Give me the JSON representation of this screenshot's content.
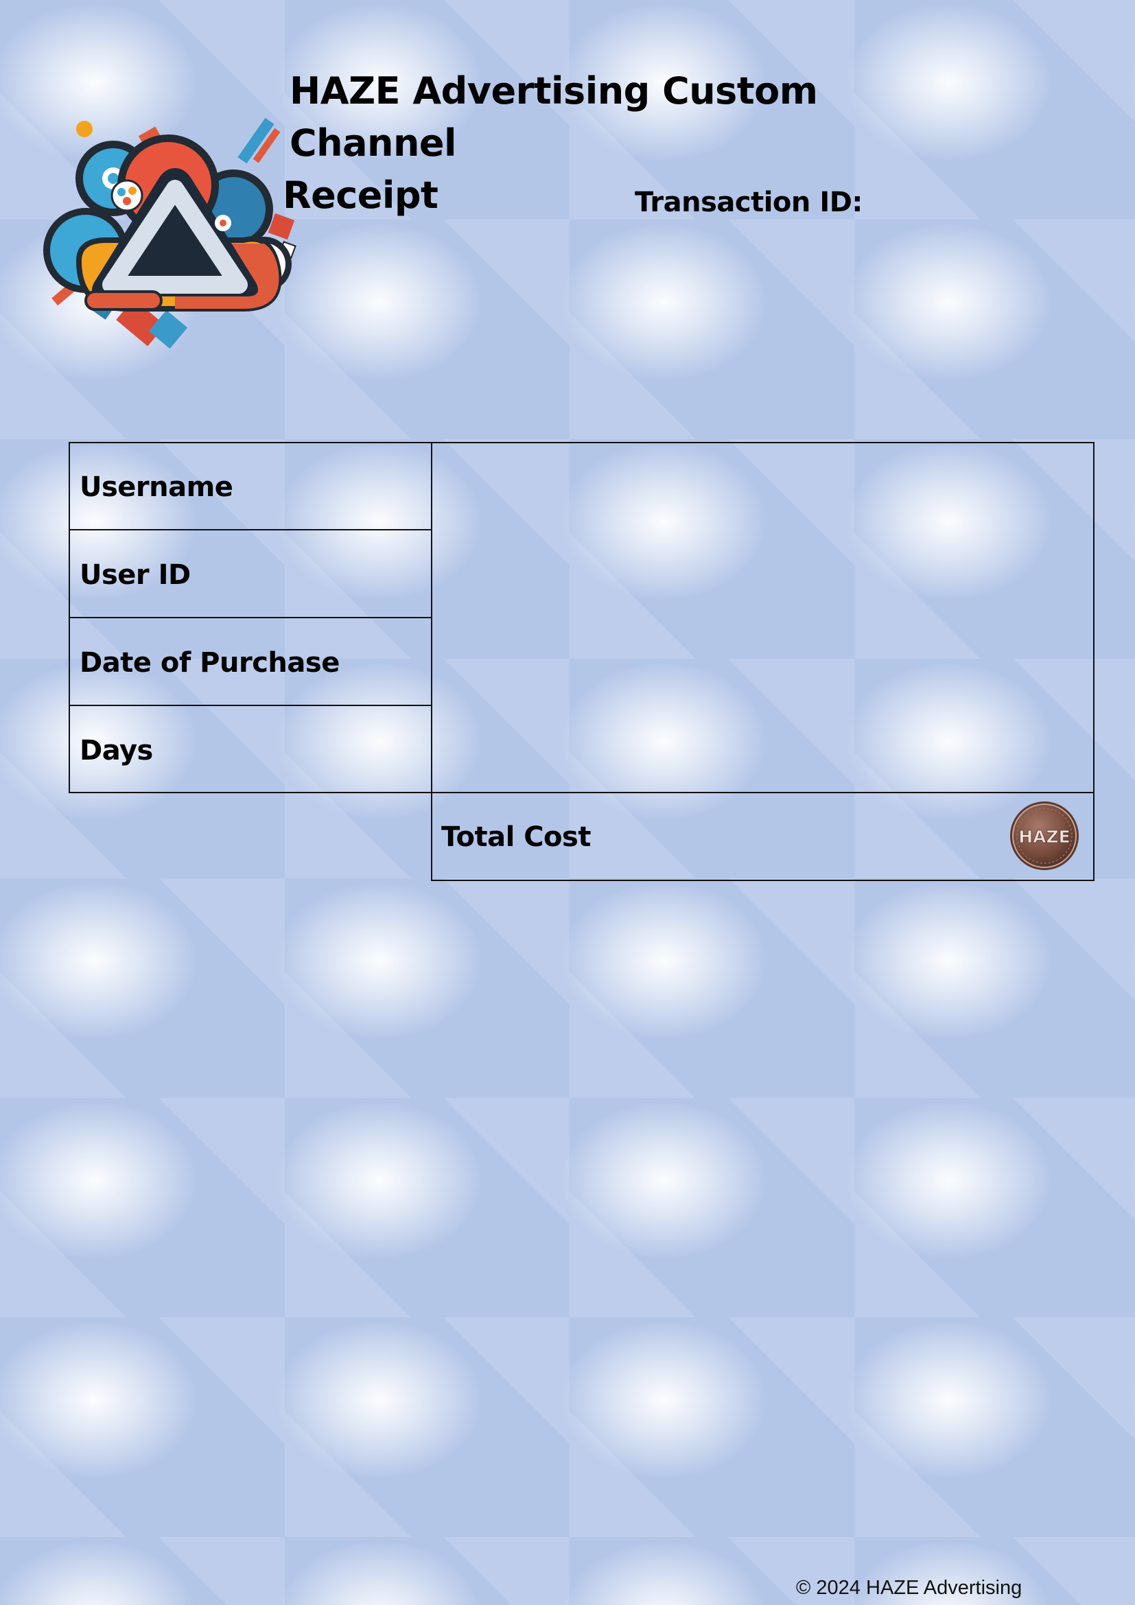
{
  "document": {
    "title_line1": "HAZE Advertising Custom Channel",
    "title_line2": "Receipt",
    "transaction_id_label": "Transaction ID:",
    "logo_icon": "haze-triangle-cloud-logo"
  },
  "receipt_table": {
    "fields": [
      {
        "label": "Username",
        "value": ""
      },
      {
        "label": "User ID",
        "value": ""
      },
      {
        "label": "Date of Purchase",
        "value": ""
      },
      {
        "label": "Days",
        "value": ""
      }
    ],
    "total_label": "Total Cost",
    "total_value": "",
    "currency_coin_text": "HAZE"
  },
  "footer": {
    "copyright": "© 2024 HAZE Advertising"
  },
  "colors": {
    "background": "#b4c6e8",
    "border": "#111111",
    "coin": "#7a4e3e"
  }
}
